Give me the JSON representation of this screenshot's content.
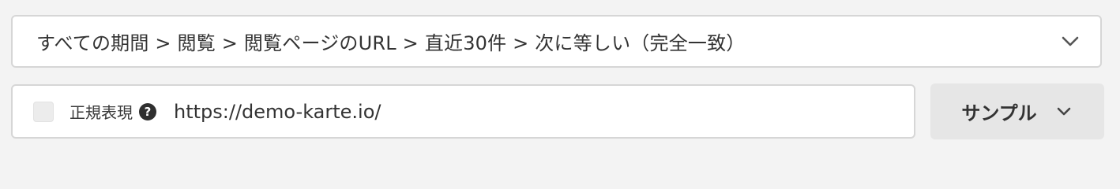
{
  "condition": {
    "breadcrumb": "すべての期間 > 閲覧 > 閲覧ページのURL > 直近30件 > 次に等しい（完全一致）",
    "toggle_icon": "chevron-down-icon"
  },
  "value_input": {
    "regex_label": "正規表現",
    "help_icon_glyph": "?",
    "value": "https://demo-karte.io/"
  },
  "sample_button": {
    "label": "サンプル",
    "icon": "chevron-down-icon"
  }
}
